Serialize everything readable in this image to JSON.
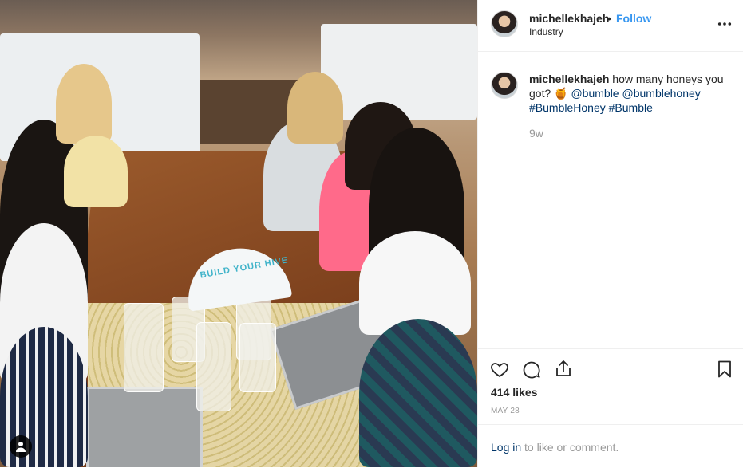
{
  "post": {
    "username": "michellekhajeh",
    "dot": "•",
    "follow_label": "Follow",
    "location": "Industry"
  },
  "photo": {
    "fan_text": "BUILD YOUR HIVE"
  },
  "caption": {
    "username": "michellekhajeh",
    "text": "how many honeys you got?",
    "emoji": "🍯",
    "mention1": "@bumble",
    "mention2": "@bumblehoney",
    "hashtag1": "#BumbleHoney",
    "hashtag2": "#Bumble",
    "time": "9w"
  },
  "actions": {
    "like_icon": "heart-icon",
    "comment_icon": "comment-icon",
    "share_icon": "share-icon",
    "save_icon": "bookmark-icon"
  },
  "stats": {
    "likes": "414 likes",
    "date": "MAY 28"
  },
  "login": {
    "link": "Log in",
    "rest": " to like or comment."
  },
  "colors": {
    "link_blue": "#3897f0",
    "mention_blue": "#003569",
    "muted": "#999999",
    "border": "#efefef"
  }
}
